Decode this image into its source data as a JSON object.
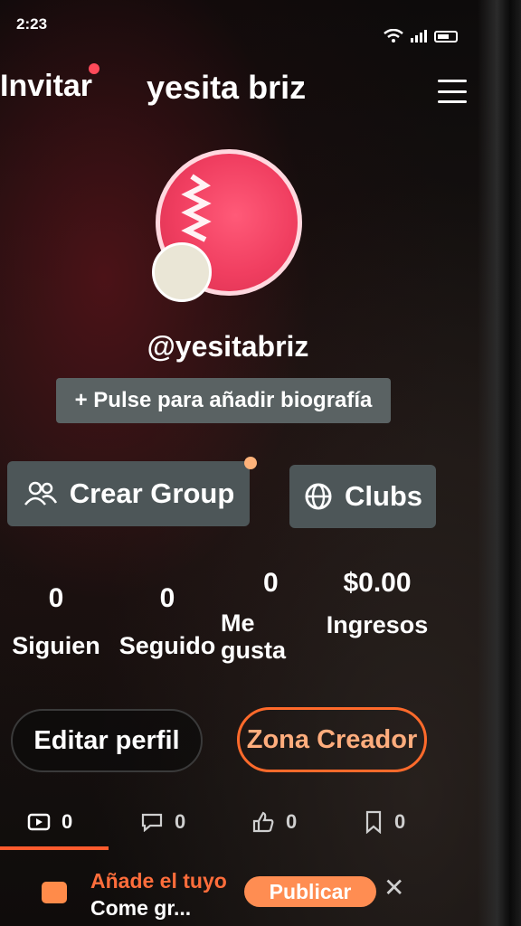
{
  "status": {
    "time": "2:23"
  },
  "header": {
    "invite_label": "Invitar",
    "title": "yesita briz"
  },
  "profile": {
    "handle": "@yesitabriz",
    "bio_prompt": "+ Pulse para añadir biografía"
  },
  "actions": {
    "create_group": "Crear Group",
    "clubs": "Clubs"
  },
  "stats": [
    {
      "value": "0",
      "label": "Siguien"
    },
    {
      "value": "0",
      "label": "Seguido"
    },
    {
      "value": "0",
      "label_line1": "Me",
      "label_line2": "gusta"
    },
    {
      "value": "$0.00",
      "label": "Ingresos"
    }
  ],
  "buttons": {
    "edit_profile": "Editar perfil",
    "creator_zone": "Zona Creador"
  },
  "tabs": [
    {
      "icon": "video-icon",
      "count": "0"
    },
    {
      "icon": "comment-icon",
      "count": "0"
    },
    {
      "icon": "thumbs-up-icon",
      "count": "0"
    },
    {
      "icon": "bookmark-icon",
      "count": "0"
    }
  ],
  "banner": {
    "title": "Añade el tuyo",
    "subtitle": "Come gr...",
    "publish_label": "Publicar"
  },
  "colors": {
    "accent": "#ff5b2e",
    "creator_text": "#ffad7d",
    "notify_dot": "#ff4a5a"
  }
}
